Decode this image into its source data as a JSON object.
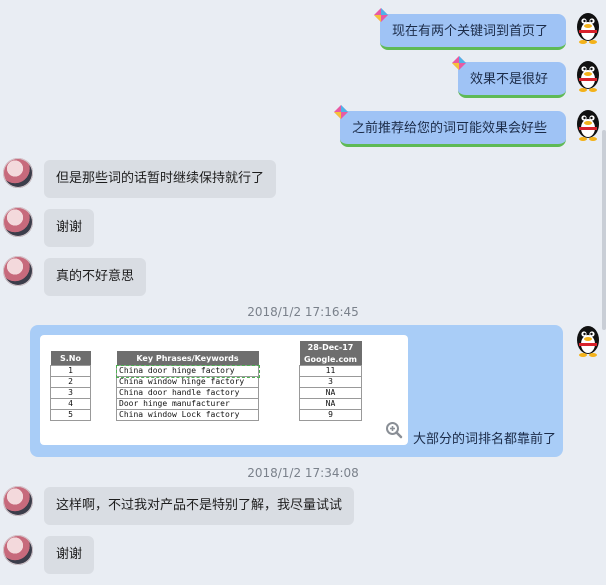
{
  "messages": {
    "m1": "现在有两个关键词到首页了",
    "m2": "效果不是很好",
    "m3": "之前推荐给您的词可能效果会好些",
    "m4": "但是那些词的话暂时继续保持就行了",
    "m5": "谢谢",
    "m6": "真的不好意思",
    "m7": "大部分的词排名都靠前了",
    "m8": "这样啊，不过我对产品不是特别了解，我尽量试试",
    "m9": "谢谢"
  },
  "timestamps": {
    "t1": "2018/1/2 17:16:45",
    "t2": "2018/1/2 17:34:08"
  },
  "image": {
    "table1": {
      "headers": [
        "S.No",
        "Key Phrases/Keywords"
      ],
      "rows": [
        [
          "1",
          "China door hinge factory"
        ],
        [
          "2",
          "China window hinge factory"
        ],
        [
          "3",
          "China door handle factory"
        ],
        [
          "4",
          "Door hinge manufacturer"
        ],
        [
          "5",
          "China window Lock factory"
        ]
      ]
    },
    "table2": {
      "header_line1": "28-Dec-17",
      "header_line2": "Google.com",
      "values": [
        "11",
        "3",
        "NA",
        "NA",
        "9"
      ]
    }
  },
  "colors": {
    "chat_bg": "#e9edf3",
    "incoming_bubble": "#d9dde3",
    "outgoing_bubble": "#9fc3f5",
    "accent_green": "#5fba55"
  },
  "icons": {
    "outgoing_avatar": "penguin-avatar-icon",
    "incoming_avatar": "user-avatar-icon",
    "zoom": "zoom-in-icon",
    "kite": "kite-icon"
  }
}
